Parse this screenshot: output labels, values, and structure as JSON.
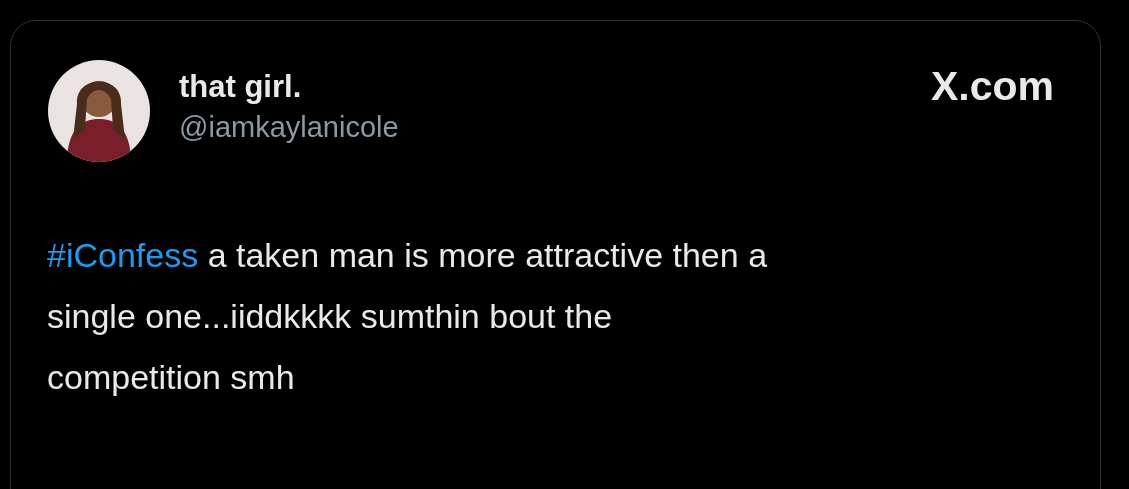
{
  "author": {
    "name": "that girl.",
    "handle": "@iamkaylanicole"
  },
  "source": "X.com",
  "tweet": {
    "hashtag": "#iConfess",
    "lines": [
      "a taken man is more attractive then a",
      "single one...iiddkkkk sumthin bout the",
      "competition smh"
    ]
  }
}
